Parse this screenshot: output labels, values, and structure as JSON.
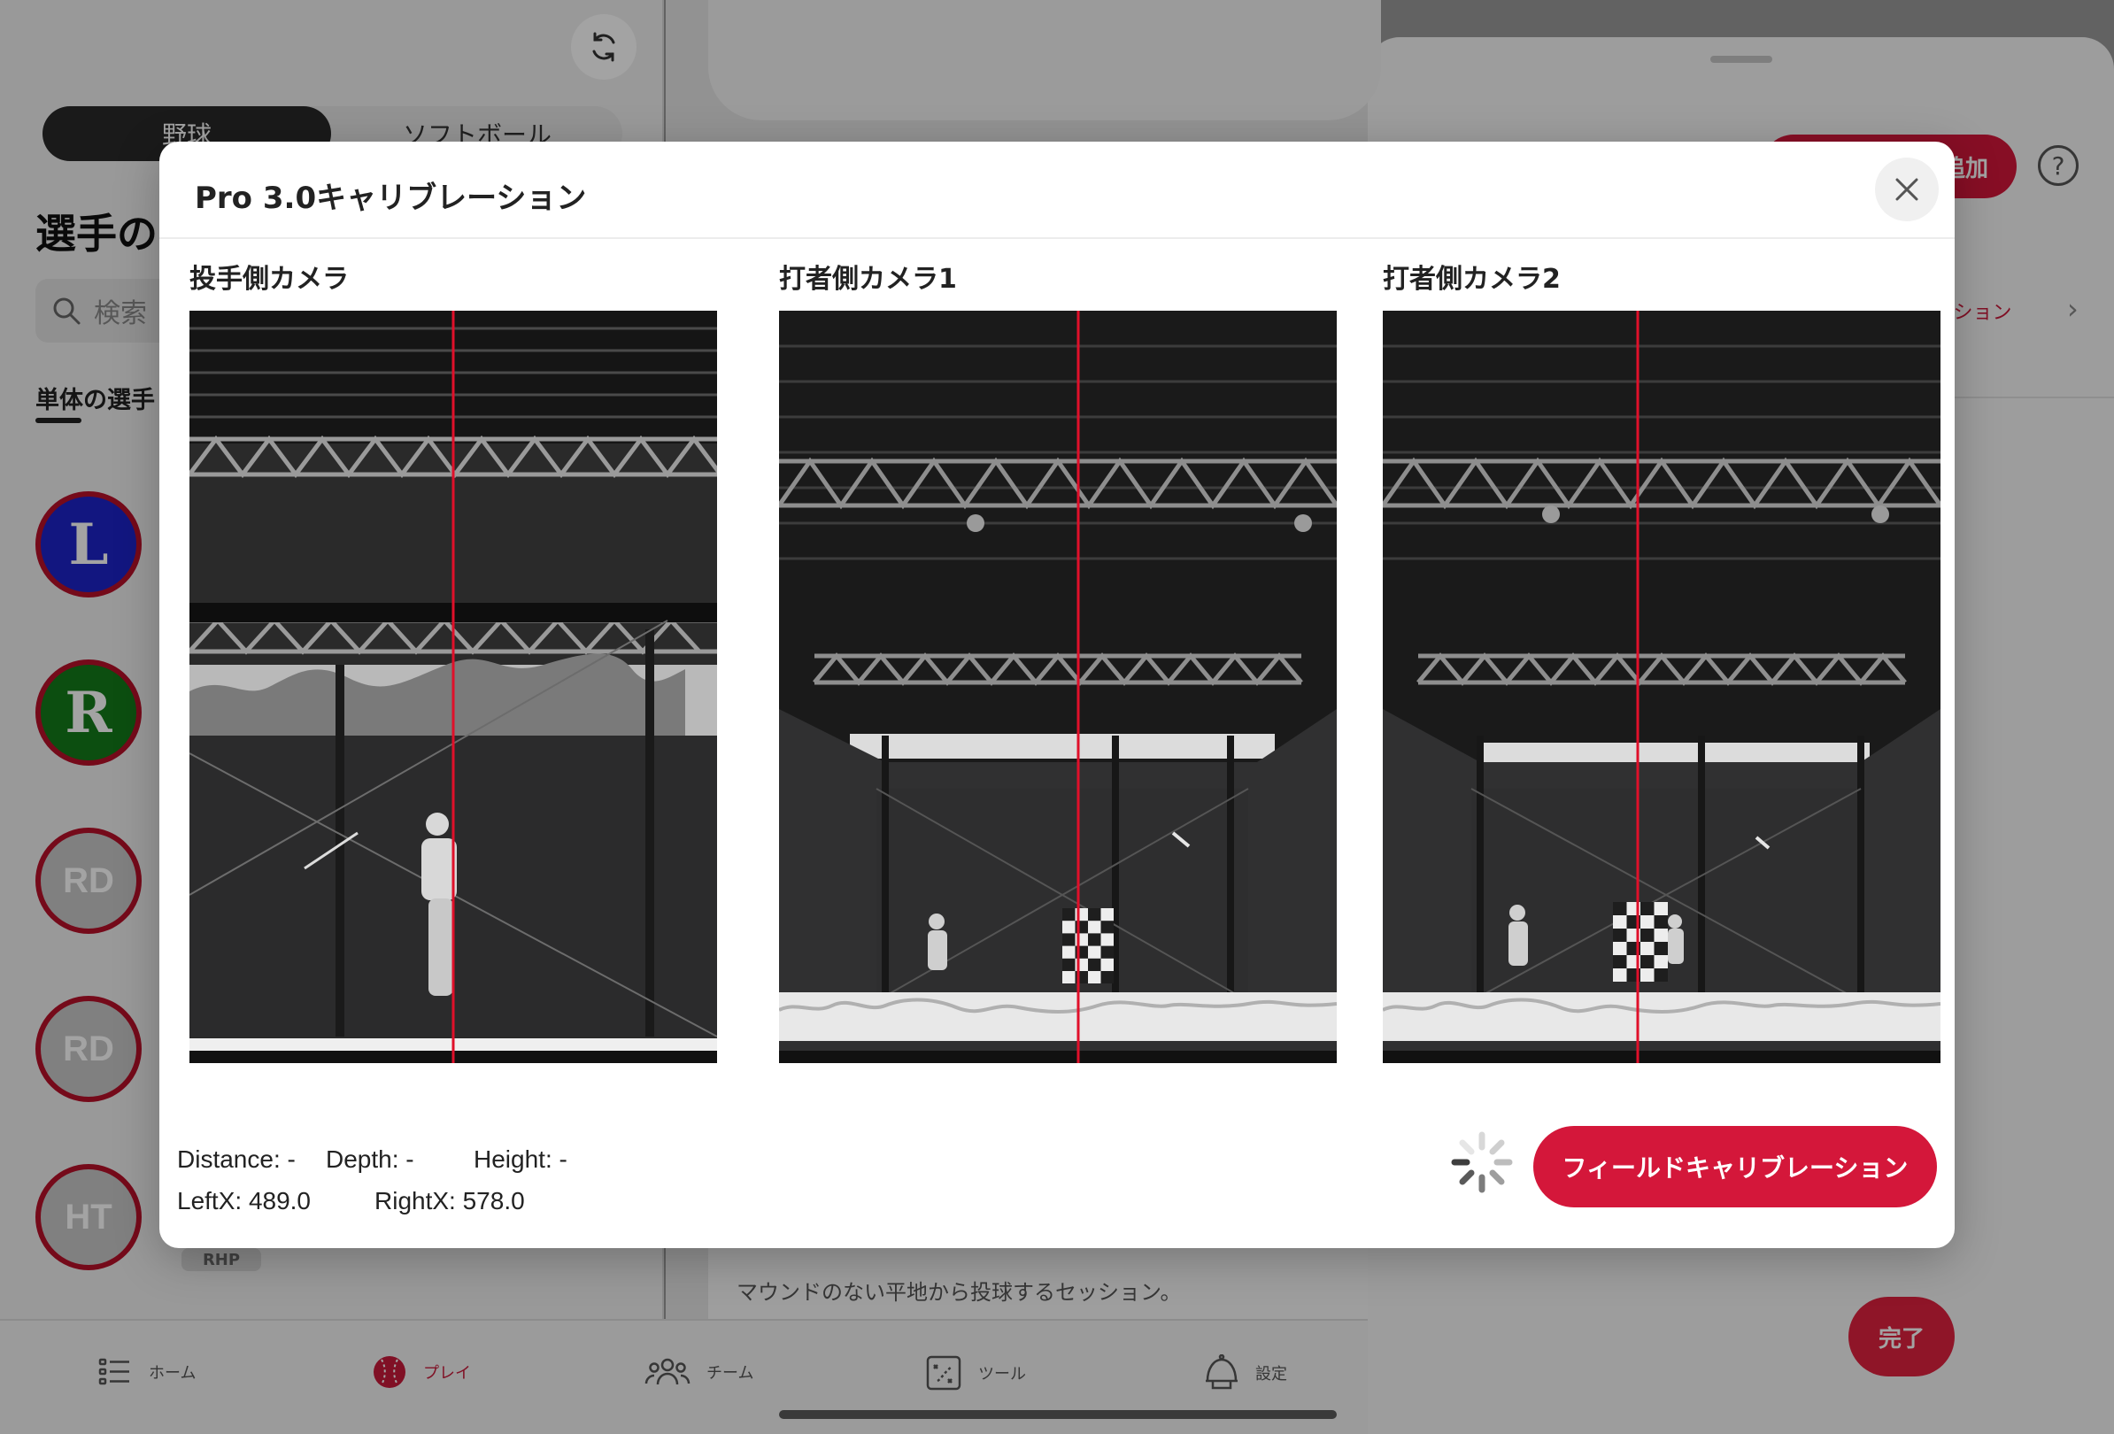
{
  "left_panel": {
    "segments": [
      "野球",
      "ソフトボール"
    ],
    "title": "選手の",
    "search_placeholder": "検索",
    "single_tab": "単体の選手",
    "avatars": [
      {
        "label": "L",
        "color": "#1d23c8"
      },
      {
        "label": "R",
        "color": "#137a1a"
      },
      {
        "label": "RD",
        "color": "#c8c8c8"
      },
      {
        "label": "RD",
        "color": "#c8c8c8"
      },
      {
        "label": "HT",
        "color": "#c8c8c8"
      }
    ],
    "badge": "RHP"
  },
  "center_panel": {
    "flat_desc": "マウンドのない平地から投球するセッション。"
  },
  "right_panel": {
    "add_button": "追加",
    "help": "?",
    "link_text": "ーション",
    "done_button": "完了"
  },
  "tabbar": {
    "items": [
      {
        "label": "ホーム",
        "icon": "list-icon"
      },
      {
        "label": "プレイ",
        "icon": "baseball-icon",
        "active": true
      },
      {
        "label": "チーム",
        "icon": "team-icon"
      },
      {
        "label": "ツール",
        "icon": "strategy-board-icon"
      },
      {
        "label": "設定",
        "icon": "helmet-icon"
      }
    ]
  },
  "modal": {
    "title": "Pro 3.0キャリブレーション",
    "cameras": [
      {
        "label": "投手側カメラ"
      },
      {
        "label": "打者側カメラ1"
      },
      {
        "label": "打者側カメラ2"
      }
    ],
    "readouts": {
      "distance": "Distance: -",
      "depth": "Depth: -",
      "height": "Height: -",
      "leftx": "LeftX: 489.0",
      "rightx": "RightX: 578.0"
    },
    "field_button": "フィールドキャリブレーション",
    "accent": "#d4173a",
    "calibration_line_color": "#e0102a"
  }
}
